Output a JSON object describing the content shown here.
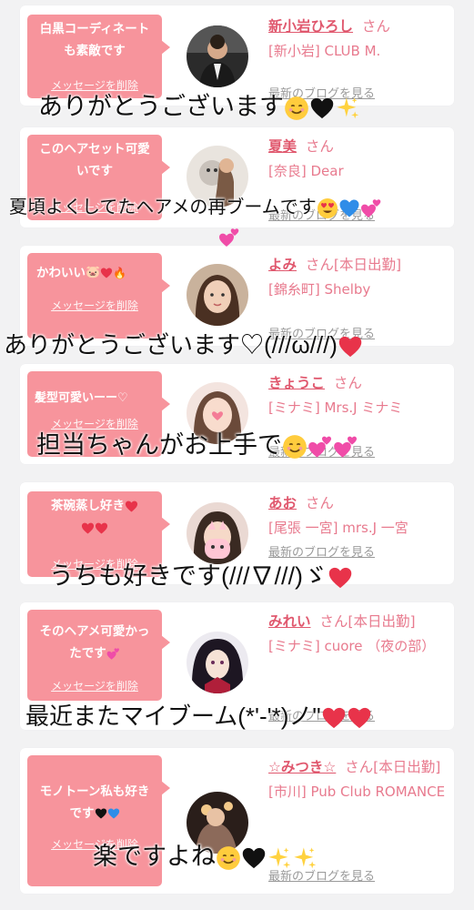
{
  "comments": [
    {
      "message": "白黒コーディネートも素敵です",
      "delete_label": "メッセージを削除",
      "name": "新小岩ひろし",
      "honorific": "さん",
      "status": "",
      "shop": "[新小岩] CLUB M.",
      "blog_link": "最新のブログを見る",
      "caption": "ありがとうございます",
      "caption_emoji": [
        "smiling-face",
        "black-heart",
        "sparkles"
      ]
    },
    {
      "message": "このヘアセット可愛いです",
      "delete_label": "メッセージを削除",
      "name": "夏美",
      "honorific": "さん",
      "status": "",
      "shop": "[奈良] Dear",
      "blog_link": "最新のブログを見る",
      "caption": "夏頃よくしてたヘアメの再ブームです",
      "caption_emoji": [
        "heart-eyes",
        "blue-heart",
        "two-hearts",
        "two-hearts"
      ]
    },
    {
      "message": "かわいい",
      "delete_label": "メッセージを削除",
      "name": "よみ",
      "honorific": "さん",
      "status": "[本日出勤]",
      "shop": "[錦糸町] Shelby",
      "blog_link": "最新のブログを見る",
      "caption": "ありがとうございます♡(///ω///)",
      "caption_emoji": [
        "red-heart"
      ]
    },
    {
      "message": "髪型可愛いーー♡",
      "delete_label": "メッセージを削除",
      "name": "きょうこ",
      "honorific": "さん",
      "status": "",
      "shop": "[ミナミ] Mrs.J ミナミ",
      "blog_link": "最新のブログを見る",
      "caption": "担当ちゃんがお上手で",
      "caption_emoji": [
        "smiling-face",
        "two-hearts",
        "two-hearts"
      ]
    },
    {
      "message": "茶碗蒸し好き",
      "delete_label": "メッセージを削除",
      "name": "あお",
      "honorific": "さん",
      "status": "",
      "shop": "[尾張 一宮] mrs.J 一宮",
      "blog_link": "最新のブログを見る",
      "caption": "うちも好きです(///∇///)ゞ",
      "caption_emoji": [
        "red-heart"
      ]
    },
    {
      "message": "そのヘアメ可愛かったです",
      "delete_label": "メッセージを削除",
      "name": "みれい",
      "honorific": "さん",
      "status": "[本日出勤]",
      "shop": "[ミナミ] cuore （夜の部）",
      "blog_link": "最新のブログを見る",
      "caption": "最近またマイブーム(*'-'*)ノ\"",
      "caption_emoji": [
        "red-heart",
        "red-heart"
      ]
    },
    {
      "message": "モノトーン私も好きです",
      "delete_label": "メッセージを削除",
      "name": "☆みつき☆",
      "honorific": "さん",
      "status": "[本日出勤]",
      "shop": "[市川] Pub Club ROMANCE",
      "blog_link": "最新のブログを見る",
      "caption": "楽ですよね",
      "caption_emoji": [
        "relieved-face",
        "black-heart",
        "sparkles",
        "sparkles"
      ]
    }
  ],
  "colors": {
    "background": "#f2f2f3",
    "bubble": "#f7949c",
    "name": "#e0586e",
    "shop": "#e87a8e",
    "blog": "#9a9a9a"
  }
}
